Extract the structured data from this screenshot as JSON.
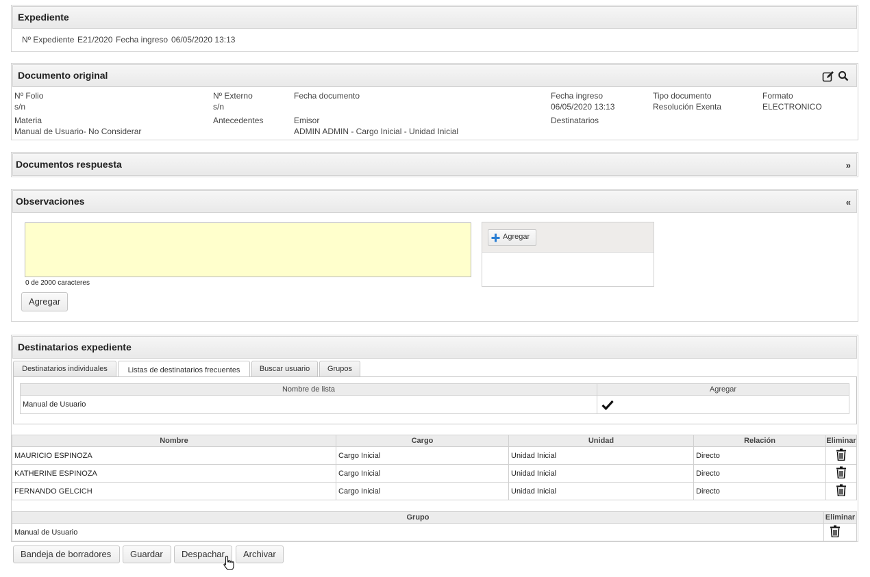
{
  "expediente": {
    "title": "Expediente",
    "numero_label": "Nº Expediente",
    "numero_value": "E21/2020",
    "fecha_label": "Fecha ingreso",
    "fecha_value": "06/05/2020 13:13"
  },
  "documento": {
    "title": "Documento original",
    "folio_label": "Nº Folio",
    "folio_value": "s/n",
    "externo_label": "Nº Externo",
    "externo_value": "s/n",
    "fecha_doc_label": "Fecha documento",
    "fecha_ingreso_label": "Fecha ingreso",
    "fecha_ingreso_value": "06/05/2020 13:13",
    "tipo_label": "Tipo documento",
    "tipo_value": "Resolución Exenta",
    "formato_label": "Formato",
    "formato_value": "ELECTRONICO",
    "materia_label": "Materia",
    "materia_value": "Manual de Usuario- No Considerar",
    "antecedentes_label": "Antecedentes",
    "emisor_label": "Emisor",
    "emisor_value": "ADMIN ADMIN - Cargo Inicial - Unidad Inicial",
    "destinatarios_label": "Destinatarios"
  },
  "respuesta": {
    "title": "Documentos respuesta",
    "toggle": "»"
  },
  "observaciones": {
    "title": "Observaciones",
    "toggle": "«",
    "textarea_value": "",
    "char_count": "0 de 2000 caracteres",
    "agregar_button": "Agregar",
    "side_agregar_button": "Agregar"
  },
  "destinatarios": {
    "title": "Destinatarios expediente",
    "tabs": [
      "Destinatarios individuales",
      "Listas de destinatarios frecuentes",
      "Buscar usuario",
      "Grupos"
    ],
    "active_tab": "Listas de destinatarios frecuentes",
    "lista_headers": [
      "Nombre de lista",
      "Agregar"
    ],
    "lista_rows": [
      {
        "nombre": "Manual de Usuario"
      }
    ],
    "main_headers": [
      "Nombre",
      "Cargo",
      "Unidad",
      "Relación",
      "Eliminar"
    ],
    "main_rows": [
      {
        "nombre": "MAURICIO ESPINOZA",
        "cargo": "Cargo Inicial",
        "unidad": "Unidad Inicial",
        "relacion": "Directo"
      },
      {
        "nombre": "KATHERINE ESPINOZA",
        "cargo": "Cargo Inicial",
        "unidad": "Unidad Inicial",
        "relacion": "Directo"
      },
      {
        "nombre": "FERNANDO GELCICH",
        "cargo": "Cargo Inicial",
        "unidad": "Unidad Inicial",
        "relacion": "Directo"
      }
    ],
    "grupo_headers": [
      "Grupo",
      "Eliminar"
    ],
    "grupo_rows": [
      {
        "nombre": "Manual de Usuario"
      }
    ]
  },
  "footer": {
    "bandeja": "Bandeja de borradores",
    "guardar": "Guardar",
    "despachar": "Despachar",
    "archivar": "Archivar"
  },
  "colors": {
    "textarea_bg": "#ffffcc",
    "header_bg": "#ececec",
    "add_icon": "#2a7fd4"
  }
}
